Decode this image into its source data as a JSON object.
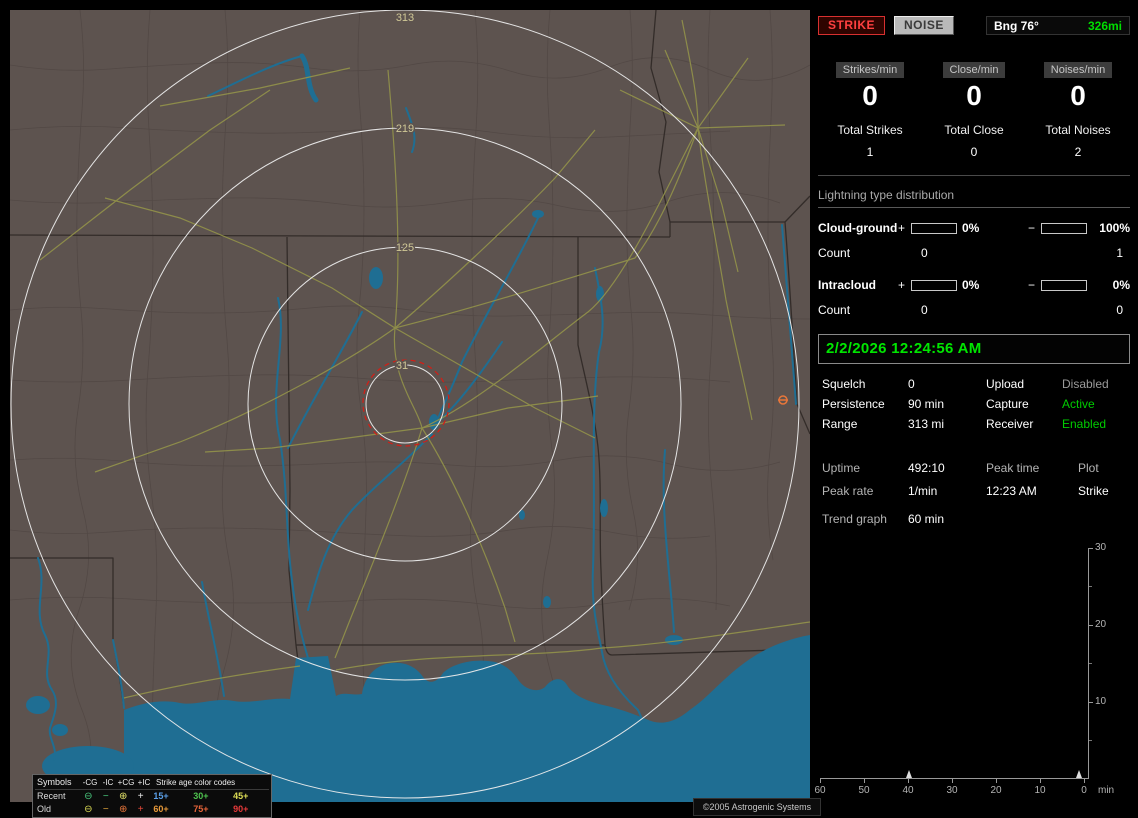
{
  "toolbar": {
    "strike": "STRIKE",
    "noise": "NOISE",
    "bearing_label": "Bng 76°",
    "bearing_range": "326mi",
    "bearing_range_color": "#00dd00"
  },
  "rates": {
    "columns": [
      {
        "chip": "Strikes/min",
        "value": "0",
        "total_label": "Total Strikes",
        "total_value": "1"
      },
      {
        "chip": "Close/min",
        "value": "0",
        "total_label": "Total Close",
        "total_value": "0"
      },
      {
        "chip": "Noises/min",
        "value": "0",
        "total_label": "Total Noises",
        "total_value": "2"
      }
    ]
  },
  "distribution": {
    "title": "Lightning type distribution",
    "plus": "+",
    "minus": "−",
    "count_label": "Count",
    "fill_color": "#76ade2",
    "rows": [
      {
        "label": "Cloud-ground",
        "plus_pct": "0%",
        "plus_fill": 0,
        "minus_pct": "100%",
        "minus_fill": 100,
        "plus_count": "0",
        "minus_count": "1"
      },
      {
        "label": "Intracloud",
        "plus_pct": "0%",
        "plus_fill": 0,
        "minus_pct": "0%",
        "minus_fill": 0,
        "plus_count": "0",
        "minus_count": "0"
      }
    ]
  },
  "clock": {
    "datetime": "2/2/2026 12:24:56 AM",
    "color": "#00e600"
  },
  "settings": {
    "rows": [
      {
        "k1": "Squelch",
        "v1": "0",
        "k2": "Upload",
        "v2": "Disabled",
        "v2_color": "#9a9a9a"
      },
      {
        "k1": "Persistence",
        "v1": "90 min",
        "k2": "Capture",
        "v2": "Active",
        "v2_color": "#00cc00"
      },
      {
        "k1": "Range",
        "v1": "313 mi",
        "k2": "Receiver",
        "v2": "Enabled",
        "v2_color": "#00cc00"
      }
    ]
  },
  "status": {
    "uptime_label": "Uptime",
    "uptime_value": "492:10",
    "peak_time_label": "Peak time",
    "peak_time_value": "12:23 AM",
    "plot_label": "Plot",
    "plot_value": "Strike",
    "peak_rate_label": "Peak rate",
    "peak_rate_value": "1/min",
    "trend_label": "Trend graph",
    "trend_value": "60 min"
  },
  "trend_graph": {
    "type": "line",
    "y_ticks": [
      "30",
      "20",
      "10"
    ],
    "x_ticks": [
      "60",
      "50",
      "40",
      "30",
      "20",
      "10",
      "0"
    ],
    "unit": "min",
    "y_max": 30,
    "window_minutes": 60,
    "spikes": [
      {
        "minutes_ago": 40,
        "value": 1
      },
      {
        "minutes_ago": 2,
        "value": 1
      }
    ]
  },
  "map": {
    "ring_labels": [
      "313",
      "219",
      "125",
      "31"
    ],
    "copyright": "©2005 Astrogenic Systems",
    "strike_marker": {
      "color": "#e8763a"
    },
    "legend": {
      "symbols_title": "Symbols",
      "columns": [
        "-CG",
        "-IC",
        "+CG",
        "+IC"
      ],
      "age_title": "Strike age color codes",
      "rows": [
        {
          "label": "Recent",
          "symbols": [
            {
              "glyph": "⊖",
              "color": "#49c97e"
            },
            {
              "glyph": "−",
              "color": "#49c97e"
            },
            {
              "glyph": "⊕",
              "color": "#e3e36a"
            },
            {
              "glyph": "+",
              "color": "#e8e8e8"
            }
          ],
          "ages": [
            {
              "text": "15+",
              "color": "#5a9fe8"
            },
            {
              "text": "30+",
              "color": "#4ec44e"
            },
            {
              "text": "45+",
              "color": "#dede55"
            }
          ]
        },
        {
          "label": "Old",
          "symbols": [
            {
              "glyph": "⊖",
              "color": "#dede55"
            },
            {
              "glyph": "−",
              "color": "#e0a43c"
            },
            {
              "glyph": "⊕",
              "color": "#e8763a"
            },
            {
              "glyph": "+",
              "color": "#e84a3a"
            }
          ],
          "ages": [
            {
              "text": "60+",
              "color": "#e89a3a"
            },
            {
              "text": "75+",
              "color": "#e8653a"
            },
            {
              "text": "90+",
              "color": "#e83a3a"
            }
          ]
        }
      ]
    }
  }
}
